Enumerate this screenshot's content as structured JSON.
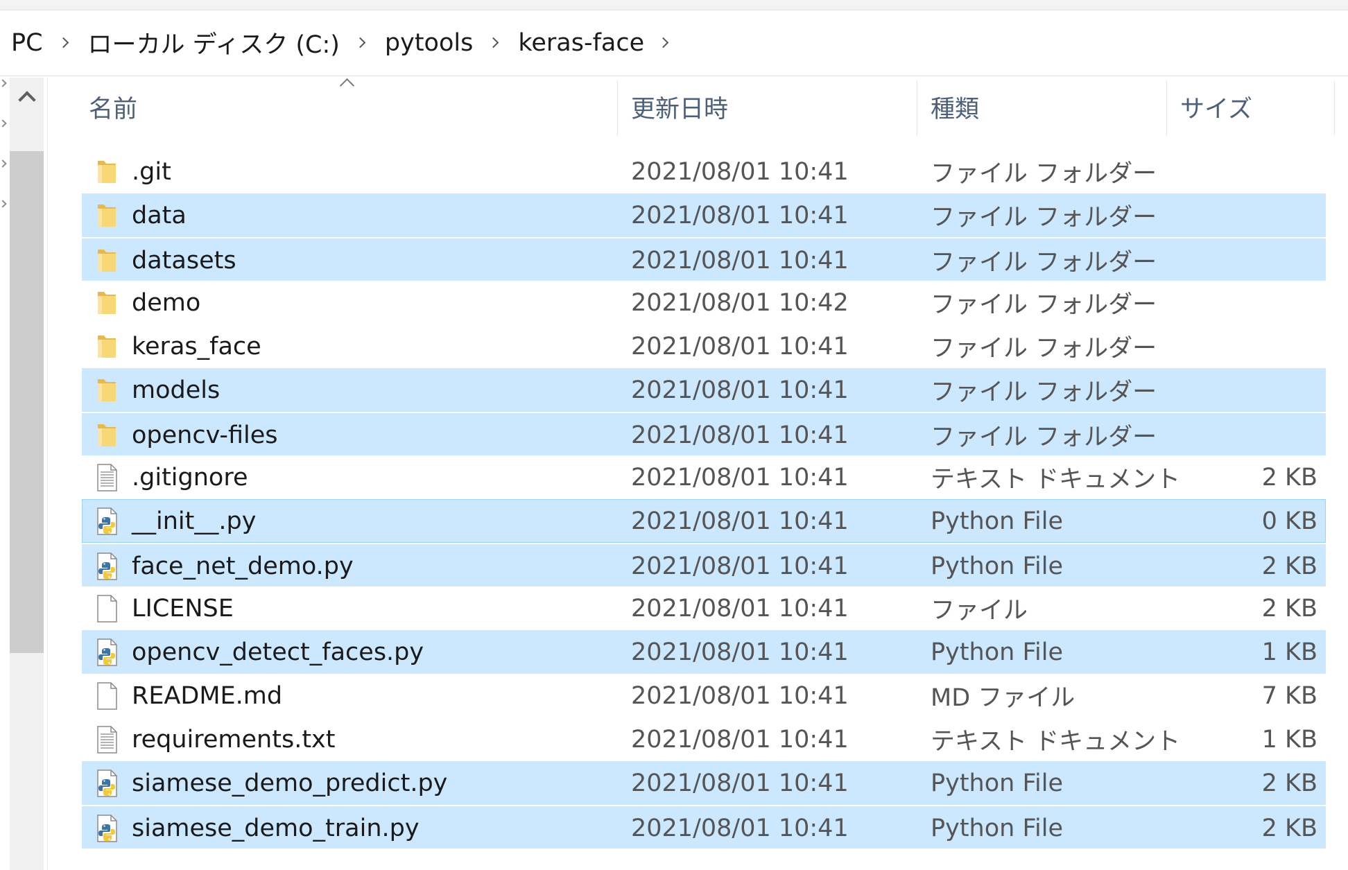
{
  "breadcrumb": {
    "items": [
      "PC",
      "ローカル ディスク (C:)",
      "pytools",
      "keras-face"
    ]
  },
  "columns": {
    "name": "名前",
    "date": "更新日時",
    "type": "種類",
    "size": "サイズ"
  },
  "files": [
    {
      "name": ".git",
      "date": "2021/08/01 10:41",
      "type": "ファイル フォルダー",
      "size": "",
      "icon": "folder-icon",
      "selected": false
    },
    {
      "name": "data",
      "date": "2021/08/01 10:41",
      "type": "ファイル フォルダー",
      "size": "",
      "icon": "folder-icon",
      "selected": true
    },
    {
      "name": "datasets",
      "date": "2021/08/01 10:41",
      "type": "ファイル フォルダー",
      "size": "",
      "icon": "folder-icon",
      "selected": true
    },
    {
      "name": "demo",
      "date": "2021/08/01 10:42",
      "type": "ファイル フォルダー",
      "size": "",
      "icon": "folder-icon",
      "selected": false
    },
    {
      "name": "keras_face",
      "date": "2021/08/01 10:41",
      "type": "ファイル フォルダー",
      "size": "",
      "icon": "folder-icon",
      "selected": false
    },
    {
      "name": "models",
      "date": "2021/08/01 10:41",
      "type": "ファイル フォルダー",
      "size": "",
      "icon": "folder-icon",
      "selected": true
    },
    {
      "name": "opencv-files",
      "date": "2021/08/01 10:41",
      "type": "ファイル フォルダー",
      "size": "",
      "icon": "folder-icon",
      "selected": true
    },
    {
      "name": ".gitignore",
      "date": "2021/08/01 10:41",
      "type": "テキスト ドキュメント",
      "size": "2 KB",
      "icon": "text-document-icon",
      "selected": false
    },
    {
      "name": "__init__.py",
      "date": "2021/08/01 10:41",
      "type": "Python File",
      "size": "0 KB",
      "icon": "python-file-icon",
      "selected": true,
      "focused": true
    },
    {
      "name": "face_net_demo.py",
      "date": "2021/08/01 10:41",
      "type": "Python File",
      "size": "2 KB",
      "icon": "python-file-icon",
      "selected": true
    },
    {
      "name": "LICENSE",
      "date": "2021/08/01 10:41",
      "type": "ファイル",
      "size": "2 KB",
      "icon": "blank-file-icon",
      "selected": false
    },
    {
      "name": "opencv_detect_faces.py",
      "date": "2021/08/01 10:41",
      "type": "Python File",
      "size": "1 KB",
      "icon": "python-file-icon",
      "selected": true
    },
    {
      "name": "README.md",
      "date": "2021/08/01 10:41",
      "type": "MD ファイル",
      "size": "7 KB",
      "icon": "blank-file-icon",
      "selected": false
    },
    {
      "name": "requirements.txt",
      "date": "2021/08/01 10:41",
      "type": "テキスト ドキュメント",
      "size": "1 KB",
      "icon": "text-document-icon",
      "selected": false
    },
    {
      "name": "siamese_demo_predict.py",
      "date": "2021/08/01 10:41",
      "type": "Python File",
      "size": "2 KB",
      "icon": "python-file-icon",
      "selected": true
    },
    {
      "name": "siamese_demo_train.py",
      "date": "2021/08/01 10:41",
      "type": "Python File",
      "size": "2 KB",
      "icon": "python-file-icon",
      "selected": true
    }
  ],
  "colors": {
    "selection": "#cce8ff",
    "selection_border": "#99d1ff",
    "folder_yellow": "#f8d775",
    "header_text": "#4c607a"
  }
}
